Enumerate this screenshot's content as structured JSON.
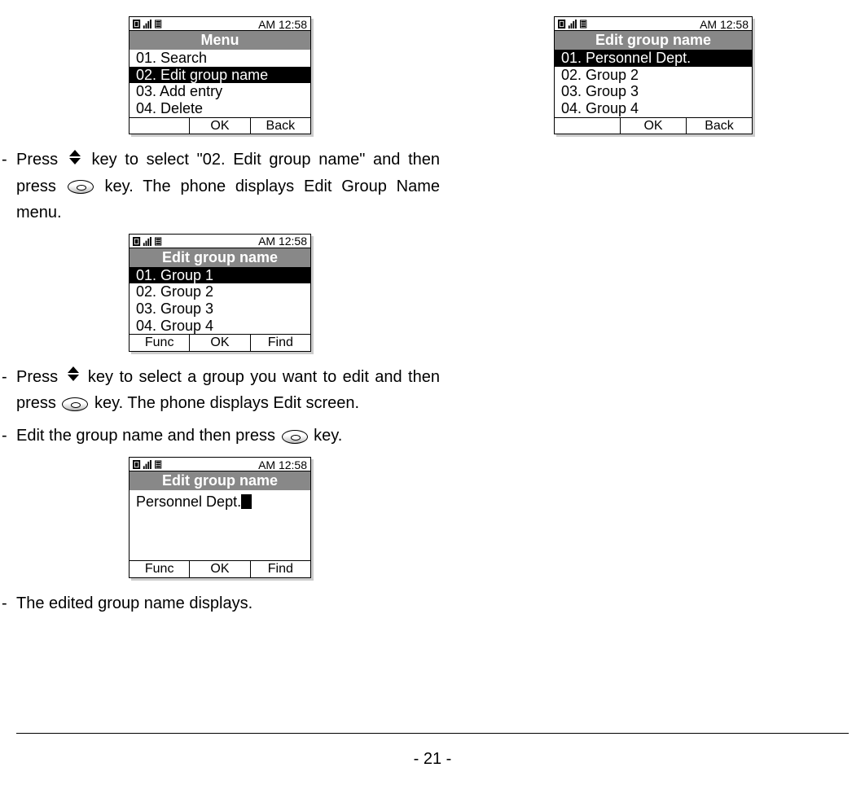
{
  "time": "AM 12:58",
  "screens": {
    "menu": {
      "title": "Menu",
      "items": [
        "01. Search",
        "02. Edit group name",
        "03. Add entry",
        "04. Delete"
      ],
      "selectedIndex": 1,
      "softkeys": [
        "",
        "OK",
        "Back"
      ]
    },
    "editGroupList1": {
      "title": "Edit group name",
      "items": [
        "01. Group 1",
        "02. Group 2",
        "03. Group 3",
        "04. Group 4"
      ],
      "selectedIndex": 0,
      "softkeys": [
        "Func",
        "OK",
        "Find"
      ]
    },
    "editGroupInput": {
      "title": "Edit group name",
      "inputValue": "Personnel Dept.",
      "softkeys": [
        "Func",
        "OK",
        "Find"
      ]
    },
    "editGroupList2": {
      "title": "Edit group name",
      "items": [
        "01. Personnel Dept.",
        "02. Group 2",
        "03. Group 3",
        "04. Group 4"
      ],
      "selectedIndex": 0,
      "softkeys": [
        "",
        "OK",
        "Back"
      ]
    }
  },
  "instructions": {
    "step1_a": "Press ",
    "step1_b": " key to select \"02. Edit group name\" and then press ",
    "step1_c": " key. The phone displays Edit Group Name menu.",
    "step2_a": "Press ",
    "step2_b": " key to select a group you want to edit and then press ",
    "step2_c": " key. The phone displays Edit screen.",
    "step3_a": "Edit the group name and then press ",
    "step3_b": " key.",
    "step4": "The edited group name displays."
  },
  "pageNumber": "- 21 -"
}
